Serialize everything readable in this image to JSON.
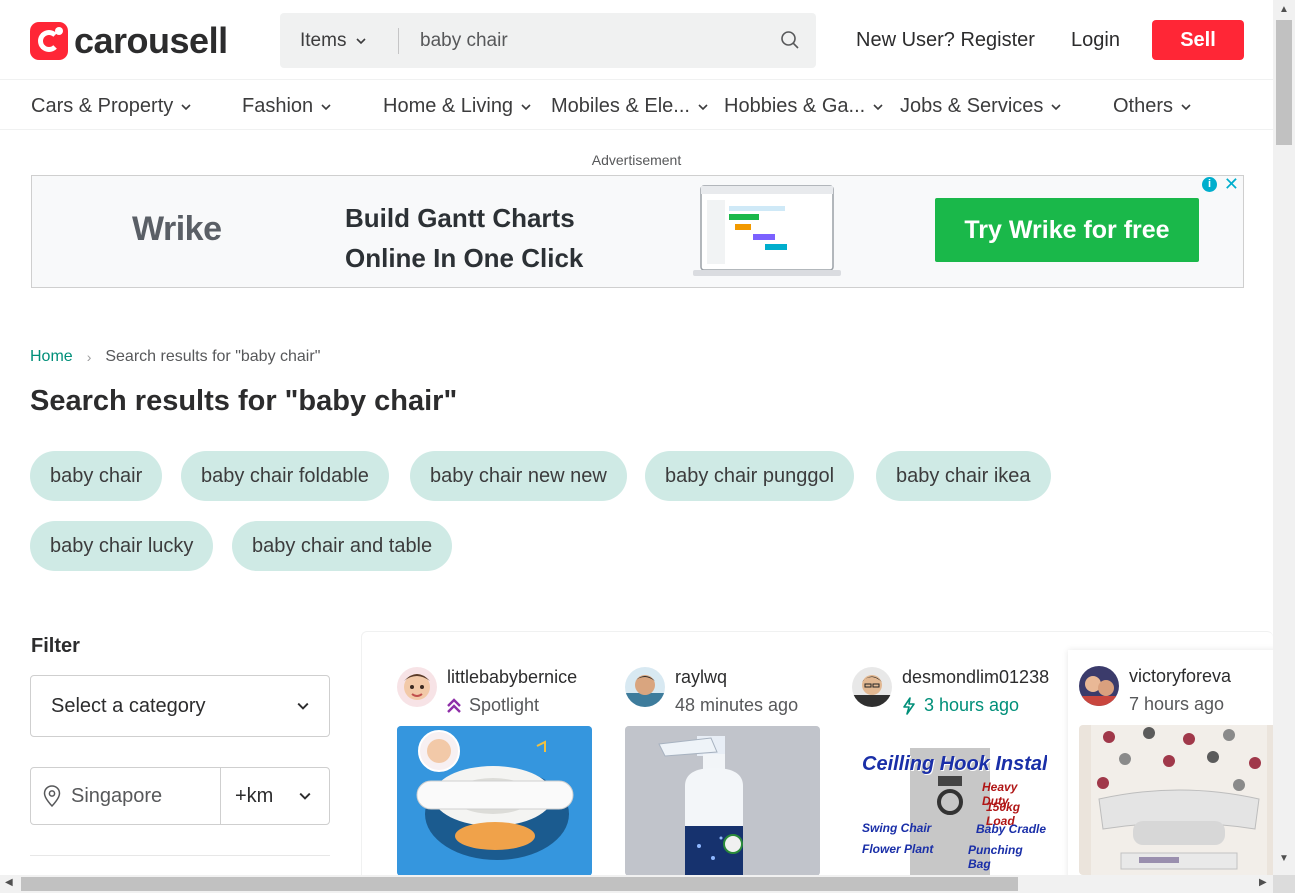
{
  "header": {
    "logo_text": "carousell",
    "search": {
      "type_label": "Items",
      "query": "baby chair"
    },
    "register_label": "New User? Register",
    "login_label": "Login",
    "sell_label": "Sell"
  },
  "categories": [
    "Cars & Property",
    "Fashion",
    "Home & Living",
    "Mobiles & Ele...",
    "Hobbies & Ga...",
    "Jobs & Services",
    "Others"
  ],
  "ad": {
    "label": "Advertisement",
    "brand": "Wrike",
    "headline_line1": "Build Gantt Charts",
    "headline_line2": "Online In One Click",
    "cta": "Try Wrike for free",
    "info_glyph": "i",
    "close_glyph": "✕"
  },
  "breadcrumb": {
    "home": "Home",
    "separator": "›",
    "current": "Search results for \"baby chair\""
  },
  "page_title": "Search results for \"baby chair\"",
  "related_searches": [
    "baby chair",
    "baby chair foldable",
    "baby chair new new",
    "baby chair punggol",
    "baby chair ikea",
    "baby chair lucky",
    "baby chair and table"
  ],
  "filter": {
    "title": "Filter",
    "category_placeholder": "Select a category",
    "location": "Singapore",
    "distance": "+km"
  },
  "listings": [
    {
      "seller": "littlebabybernice",
      "meta": "Spotlight",
      "meta_kind": "spotlight"
    },
    {
      "seller": "raylwq",
      "meta": "48 minutes ago",
      "meta_kind": "time"
    },
    {
      "seller": "desmondlim01238",
      "meta": "3 hours ago",
      "meta_kind": "bump",
      "image_text": [
        "Ceilling Hook Install",
        "Heavy Duty",
        "150kg Load",
        "Swing Chair",
        "Baby Cradle",
        "Flower Plant",
        "Punching Bag"
      ]
    },
    {
      "seller": "victoryforeva",
      "meta": "7 hours ago",
      "meta_kind": "time"
    }
  ],
  "colors": {
    "brand": "#ff2636",
    "pill": "#cfeae5",
    "link": "#008f79",
    "ad_green": "#1ab84a"
  }
}
